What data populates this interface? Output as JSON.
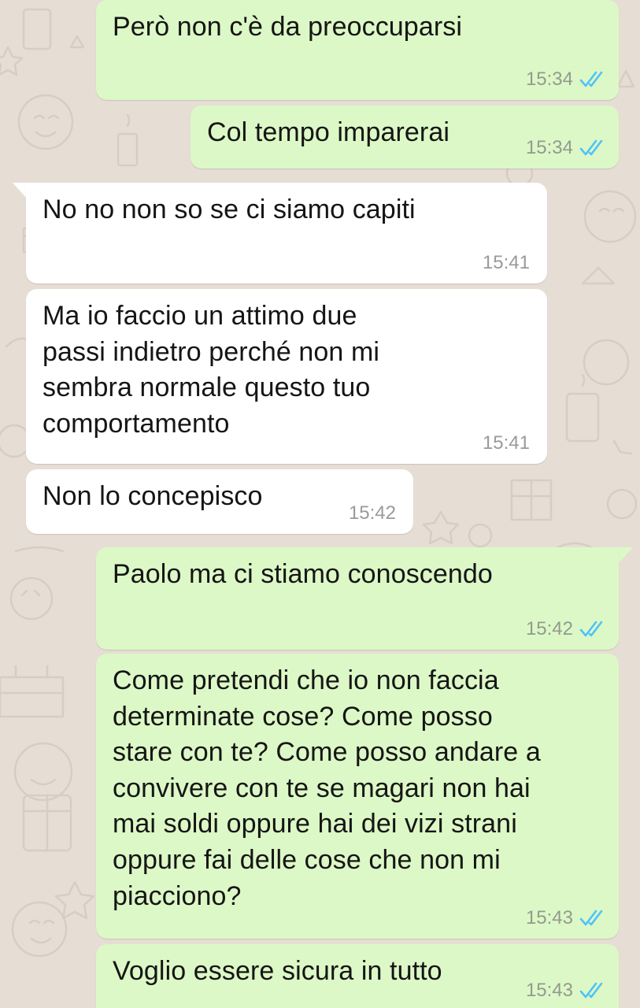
{
  "chat": {
    "messages": [
      {
        "direction": "outgoing",
        "text": "Però non c'è da preoccuparsi",
        "time": "15:34",
        "read_receipt": "double-check-blue"
      },
      {
        "direction": "outgoing",
        "text": "Col tempo imparerai",
        "time": "15:34",
        "read_receipt": "double-check-blue"
      },
      {
        "direction": "incoming",
        "text": "No no non so se ci siamo capiti",
        "time": "15:41"
      },
      {
        "direction": "incoming",
        "text": "Ma io faccio un attimo due\npassi indietro perché non mi\nsembra normale questo tuo\ncomportamento",
        "time": "15:41"
      },
      {
        "direction": "incoming",
        "text": "Non lo concepisco",
        "time": "15:42"
      },
      {
        "direction": "outgoing",
        "text": "Paolo ma ci stiamo conoscendo",
        "time": "15:42",
        "read_receipt": "double-check-blue"
      },
      {
        "direction": "outgoing",
        "text": "Come pretendi che io non faccia\ndeterminate cose? Come posso\nstare con te? Come posso andare a\nconvivere con te se magari non hai\nmai soldi oppure hai dei vizi strani\noppure fai delle cose che non mi\npiacciono?",
        "time": "15:43",
        "read_receipt": "double-check-blue"
      },
      {
        "direction": "outgoing",
        "text": "Voglio essere sicura in tutto",
        "time": "15:43",
        "read_receipt": "double-check-blue"
      }
    ]
  },
  "colors": {
    "wallpaper": "#e6ded5",
    "outgoing_bubble": "#dcf8c6",
    "incoming_bubble": "#ffffff",
    "read_tick": "#4fc3f7",
    "timestamp": "#939a8f"
  }
}
